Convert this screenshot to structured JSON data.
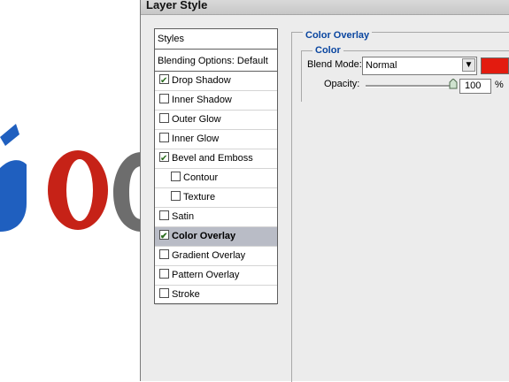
{
  "dialog": {
    "title": "Layer Style"
  },
  "styles_panel": {
    "header": "Styles",
    "blending_options": "Blending Options: Default",
    "items": [
      {
        "label": "Drop Shadow",
        "checked": true,
        "indent": false,
        "selected": false
      },
      {
        "label": "Inner Shadow",
        "checked": false,
        "indent": false,
        "selected": false
      },
      {
        "label": "Outer Glow",
        "checked": false,
        "indent": false,
        "selected": false
      },
      {
        "label": "Inner Glow",
        "checked": false,
        "indent": false,
        "selected": false
      },
      {
        "label": "Bevel and Emboss",
        "checked": true,
        "indent": false,
        "selected": false
      },
      {
        "label": "Contour",
        "checked": false,
        "indent": true,
        "selected": false
      },
      {
        "label": "Texture",
        "checked": false,
        "indent": true,
        "selected": false
      },
      {
        "label": "Satin",
        "checked": false,
        "indent": false,
        "selected": false
      },
      {
        "label": "Color Overlay",
        "checked": true,
        "indent": false,
        "selected": true
      },
      {
        "label": "Gradient Overlay",
        "checked": false,
        "indent": false,
        "selected": false
      },
      {
        "label": "Pattern Overlay",
        "checked": false,
        "indent": false,
        "selected": false
      },
      {
        "label": "Stroke",
        "checked": false,
        "indent": false,
        "selected": false
      }
    ]
  },
  "color_overlay": {
    "section_title": "Color Overlay",
    "group_title": "Color",
    "blend_mode_label": "Blend Mode:",
    "blend_mode_value": "Normal",
    "color": "#e31b0f",
    "opacity_label": "Opacity:",
    "opacity_value": "100",
    "opacity_unit": "%",
    "opacity_level": 1.0
  },
  "background": {
    "logo_letters": [
      "g",
      "o",
      "o"
    ]
  }
}
